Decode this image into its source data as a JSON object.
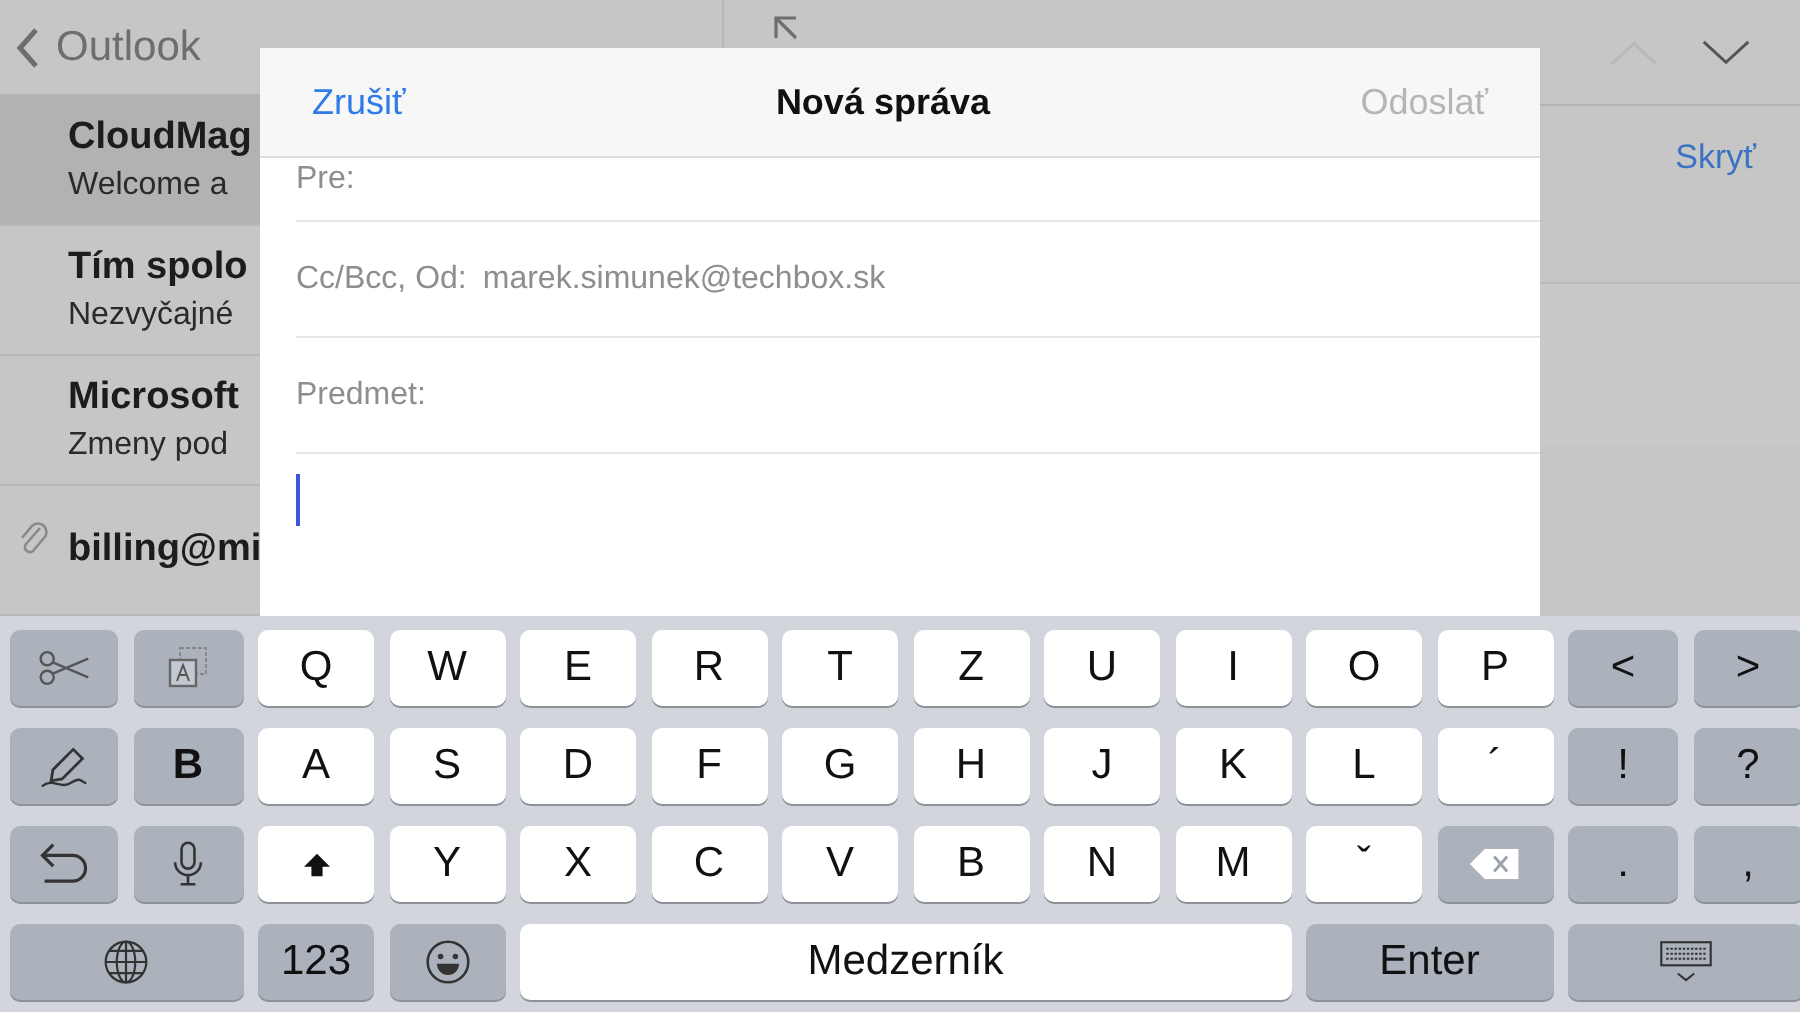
{
  "mail_app": {
    "back_button": "Outlook",
    "up_button": {
      "disabled": true
    },
    "down_button": {
      "disabled": false
    },
    "hide_button": "Skryť",
    "messages": [
      {
        "sender": "CloudMag",
        "preview": "Welcome a",
        "selected": true,
        "attachment": false
      },
      {
        "sender": "Tím spolo",
        "preview": "Nezvyčajné",
        "selected": false,
        "attachment": false
      },
      {
        "sender": "Microsoft",
        "preview": "Zmeny pod",
        "selected": false,
        "attachment": false
      },
      {
        "sender": "billing@mi",
        "selected": false,
        "attachment": true
      }
    ]
  },
  "compose": {
    "cancel": "Zrušiť",
    "title": "Nová správa",
    "send": "Odoslať",
    "send_disabled": true,
    "fields": [
      {
        "label": "Pre:"
      },
      {
        "label": "Cc/Bcc, Od:",
        "value": "marek.simunek@techbox.sk"
      },
      {
        "label": "Predmet:"
      }
    ]
  },
  "keyboard": {
    "rows": [
      [
        {
          "kind": "cut"
        },
        {
          "kind": "paste"
        },
        {
          "kind": "letter",
          "label": "Q"
        },
        {
          "kind": "letter",
          "label": "W"
        },
        {
          "kind": "letter",
          "label": "E"
        },
        {
          "kind": "letter",
          "label": "R"
        },
        {
          "kind": "letter",
          "label": "T"
        },
        {
          "kind": "letter",
          "label": "Z"
        },
        {
          "kind": "letter",
          "label": "U"
        },
        {
          "kind": "letter",
          "label": "I"
        },
        {
          "kind": "letter",
          "label": "O"
        },
        {
          "kind": "letter",
          "label": "P"
        },
        {
          "kind": "function",
          "label": "<"
        },
        {
          "kind": "function",
          "label": ">"
        }
      ],
      [
        {
          "kind": "format"
        },
        {
          "kind": "function",
          "label": "B",
          "bold": true
        },
        {
          "kind": "letter",
          "label": "A"
        },
        {
          "kind": "letter",
          "label": "S"
        },
        {
          "kind": "letter",
          "label": "D"
        },
        {
          "kind": "letter",
          "label": "F"
        },
        {
          "kind": "letter",
          "label": "G"
        },
        {
          "kind": "letter",
          "label": "H"
        },
        {
          "kind": "letter",
          "label": "J"
        },
        {
          "kind": "letter",
          "label": "K"
        },
        {
          "kind": "letter",
          "label": "L"
        },
        {
          "kind": "letter",
          "label": "´"
        },
        {
          "kind": "function",
          "label": "!"
        },
        {
          "kind": "function",
          "label": "?"
        }
      ],
      [
        {
          "kind": "undo"
        },
        {
          "kind": "dictate"
        },
        {
          "kind": "shift"
        },
        {
          "kind": "letter",
          "label": "Y"
        },
        {
          "kind": "letter",
          "label": "X"
        },
        {
          "kind": "letter",
          "label": "C"
        },
        {
          "kind": "letter",
          "label": "V"
        },
        {
          "kind": "letter",
          "label": "B"
        },
        {
          "kind": "letter",
          "label": "N"
        },
        {
          "kind": "letter",
          "label": "M"
        },
        {
          "kind": "letter",
          "label": "ˇ"
        },
        {
          "kind": "delete"
        },
        {
          "kind": "function",
          "label": "."
        },
        {
          "kind": "function",
          "label": ","
        }
      ]
    ],
    "bottom_row": [
      {
        "kind": "globe"
      },
      {
        "kind": "function",
        "label": "123"
      },
      {
        "kind": "emoji"
      },
      {
        "kind": "space",
        "label": "Medzerník"
      },
      {
        "kind": "enter",
        "label": "Enter"
      },
      {
        "kind": "dismiss"
      }
    ]
  }
}
